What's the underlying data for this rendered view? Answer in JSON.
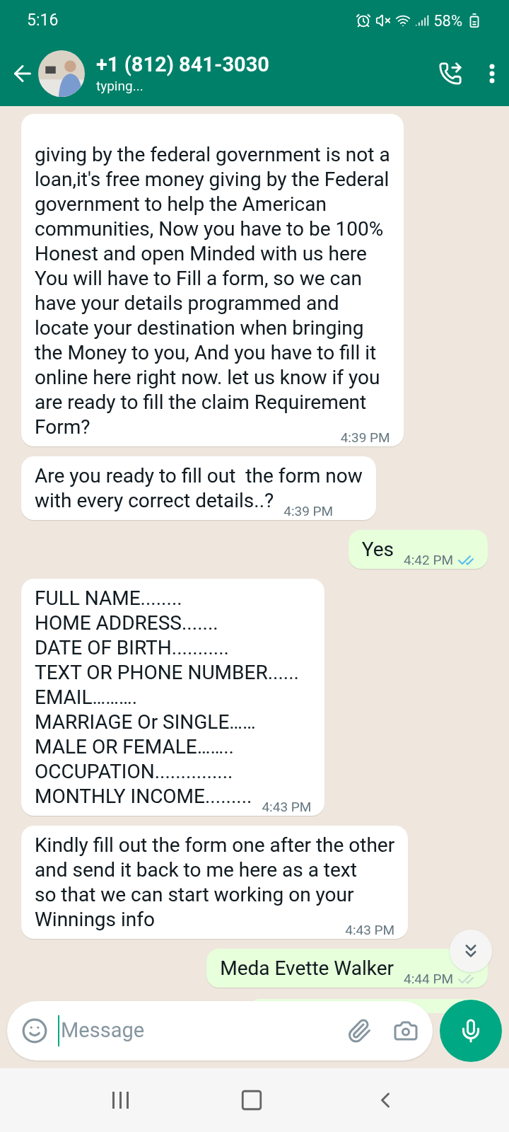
{
  "status_bar": {
    "time": "5:16",
    "battery": "58%"
  },
  "header": {
    "contact": "+1 (812) 841-3030",
    "status": "typing..."
  },
  "messages": [
    {
      "kind": "incoming",
      "lines": [
        "giving by the federal government is not a",
        "loan,it's free money giving by the Federal",
        "government to help the American",
        "communities, Now you have to be 100%",
        "Honest and open Minded with us here",
        "You will have to Fill a form, so we can",
        "have your details programmed and",
        "locate your destination when bringing",
        "the Money to you, And you have to fill it",
        "online here right now. let us know if you",
        "are ready to fill the claim Requirement",
        "Form?"
      ],
      "time": "4:39 PM"
    },
    {
      "kind": "incoming",
      "lines": [
        "Are you ready to fill out  the form now",
        "with every correct details..?"
      ],
      "time": "4:39 PM"
    },
    {
      "kind": "outgoing",
      "lines": [
        "Yes"
      ],
      "time": "4:42 PM",
      "read": true
    },
    {
      "kind": "incoming",
      "lines": [
        "FULL NAME........",
        "HOME ADDRESS.......",
        "DATE OF BIRTH...........",
        "TEXT OR PHONE NUMBER......",
        "EMAIL……….",
        "MARRIAGE Or SINGLE……",
        "MALE OR FEMALE……..",
        "OCCUPATION...............",
        "MONTHLY INCOME........."
      ],
      "time": "4:43 PM"
    },
    {
      "kind": "incoming",
      "lines": [
        "Kindly fill out the form one after the other",
        "and send it back to me here as a text",
        "so that we can start working on your",
        "Winnings info"
      ],
      "time": "4:43 PM"
    },
    {
      "kind": "outgoing",
      "lines": [
        "Meda Evette Walker"
      ],
      "time": "4:44 PM",
      "read": false
    }
  ],
  "composer": {
    "placeholder": "Message"
  }
}
